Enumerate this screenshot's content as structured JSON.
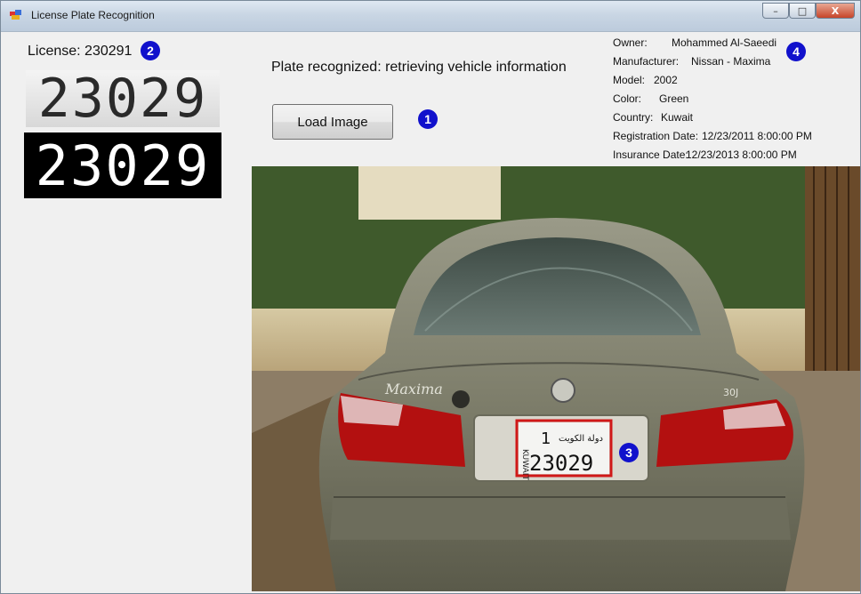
{
  "window": {
    "title": "License Plate Recognition",
    "controls": {
      "minimize": "–",
      "maximize": "□",
      "close": "X"
    }
  },
  "license": {
    "label": "License: 230291"
  },
  "plates": {
    "gray_text": "23029",
    "binary_text": "23029"
  },
  "status": {
    "text": "Plate recognized: retrieving vehicle information"
  },
  "load_button": {
    "label": "Load Image"
  },
  "vehicle_info": {
    "owner_label": "Owner:",
    "owner_value": "Mohammed Al-Saeedi",
    "manufacturer_label": "Manufacturer:",
    "manufacturer_value": "Nissan - Maxima",
    "model_label": "Model:",
    "model_value": "2002",
    "color_label": "Color:",
    "color_value": "Green",
    "country_label": "Country:",
    "country_value": "Kuwait",
    "registration_label": "Registration Date:",
    "registration_value": "12/23/2011 8:00:00 PM",
    "insurance_label": "Insurance Date:",
    "insurance_value": "12/23/2013 8:00:00 PM"
  },
  "badges": {
    "b1": "1",
    "b2": "2",
    "b3": "3",
    "b4": "4"
  },
  "photo": {
    "plate_number": "23029",
    "plate_top_digit": "1",
    "plate_arabic": "دولة الكويت",
    "plate_side": "KUWAIT",
    "trunk_badge": "Maxima",
    "trunk_trim": "30J"
  },
  "colors": {
    "badge": "#1111cc",
    "plate_box": "#d01818",
    "car_body": "#7f7f6c"
  }
}
